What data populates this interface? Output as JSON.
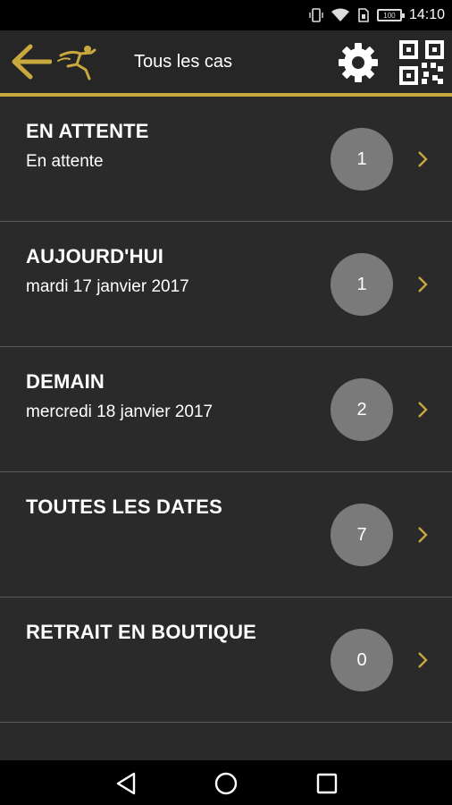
{
  "status_bar": {
    "time": "14:10",
    "battery_label": "100",
    "icons": [
      "vibrate-icon",
      "wifi-icon",
      "sim-icon",
      "battery-icon"
    ]
  },
  "header": {
    "title": "Tous les cas",
    "icons": [
      "back-arrow-icon",
      "logo-runner-icon",
      "gear-icon",
      "qr-code-icon"
    ]
  },
  "colors": {
    "accent": "#c9a93e",
    "background": "#2a2a2a",
    "badge": "#7a7a7a"
  },
  "items": [
    {
      "title": "EN ATTENTE",
      "subtitle": "En attente",
      "count": "1"
    },
    {
      "title": "AUJOURD'HUI",
      "subtitle": "mardi 17 janvier 2017",
      "count": "1"
    },
    {
      "title": "DEMAIN",
      "subtitle": "mercredi 18 janvier 2017",
      "count": "2"
    },
    {
      "title": "TOUTES LES DATES",
      "subtitle": "",
      "count": "7"
    },
    {
      "title": "RETRAIT EN BOUTIQUE",
      "subtitle": "",
      "count": "0"
    }
  ],
  "nav": {
    "icons": [
      "back-triangle-icon",
      "home-circle-icon",
      "recents-square-icon"
    ]
  }
}
